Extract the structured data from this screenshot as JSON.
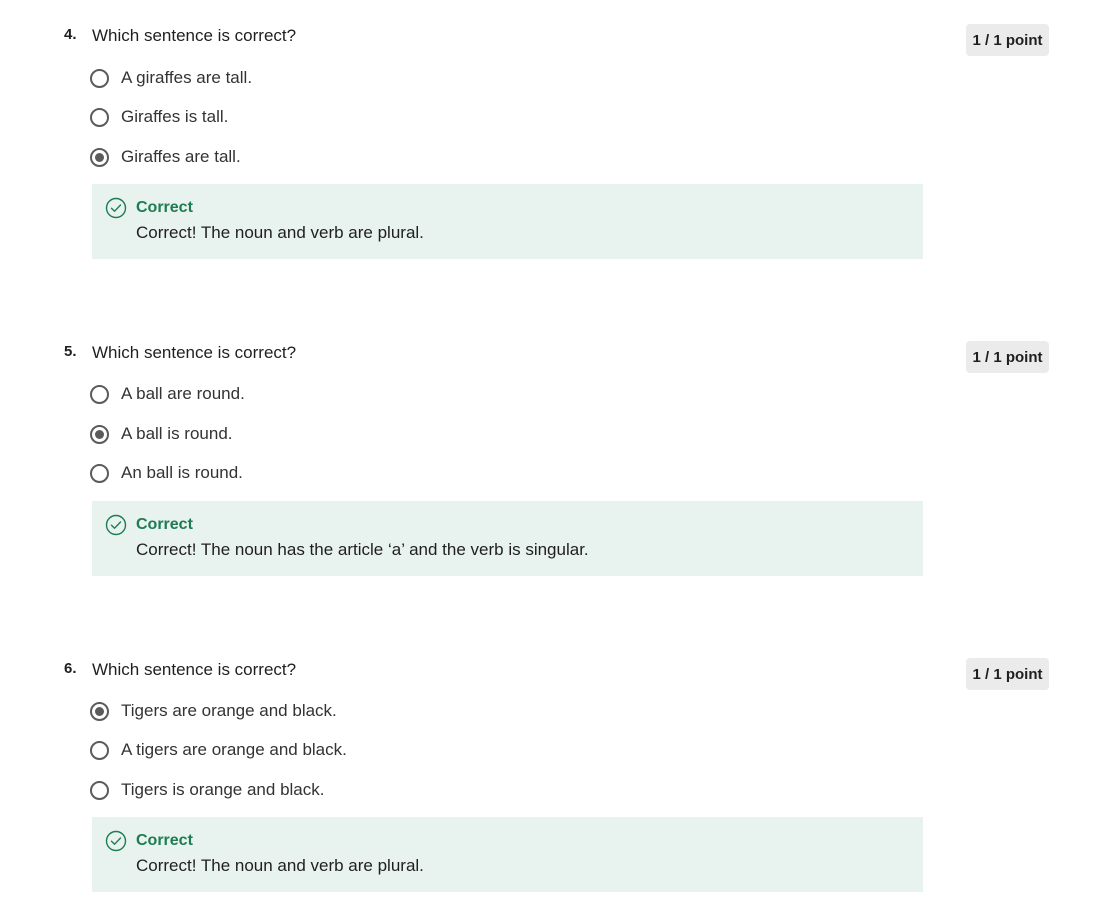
{
  "questions": [
    {
      "number": "4.",
      "prompt": "Which sentence is correct?",
      "points": "1 / 1 point",
      "options": [
        {
          "label": "A giraffes are tall.",
          "selected": false
        },
        {
          "label": "Giraffes is tall.",
          "selected": false
        },
        {
          "label": "Giraffes are tall.",
          "selected": true
        }
      ],
      "feedback": {
        "status": "Correct",
        "message": "Correct! The noun and verb are plural."
      }
    },
    {
      "number": "5.",
      "prompt": "Which sentence is correct?",
      "points": "1 / 1 point",
      "options": [
        {
          "label": "A ball are round.",
          "selected": false
        },
        {
          "label": "A ball is round.",
          "selected": true
        },
        {
          "label": "An ball is round.",
          "selected": false
        }
      ],
      "feedback": {
        "status": "Correct",
        "message": "Correct! The noun has the article ‘a’ and the verb is singular."
      }
    },
    {
      "number": "6.",
      "prompt": "Which sentence is correct?",
      "points": "1 / 1 point",
      "options": [
        {
          "label": "Tigers are orange and black.",
          "selected": true
        },
        {
          "label": "A tigers are orange and black.",
          "selected": false
        },
        {
          "label": "Tigers is orange and black.",
          "selected": false
        }
      ],
      "feedback": {
        "status": "Correct",
        "message": "Correct! The noun and verb are plural."
      }
    }
  ],
  "icons": {
    "feedback_icon": "check-circle-icon"
  },
  "colors": {
    "correct_green": "#1e7c53",
    "feedback_bg": "#e8f2ee",
    "badge_bg": "#ebebeb",
    "radio_gray": "#5b5b5b"
  }
}
